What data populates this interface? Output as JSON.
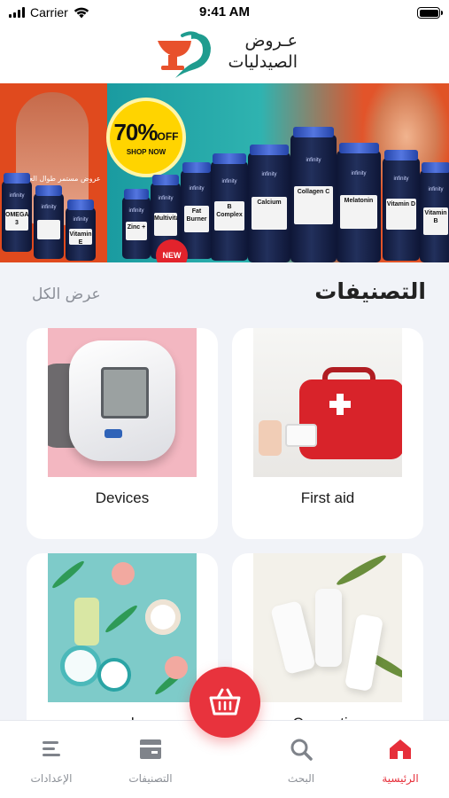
{
  "status_bar": {
    "carrier": "Carrier",
    "time": "9:41 AM"
  },
  "header": {
    "brand_line1": "عـروض",
    "brand_line2": "الصيدليات",
    "logo_colors": [
      "#e8512c",
      "#1f9c8f"
    ]
  },
  "banner": {
    "tagline": "عروض مستمر طوال العام",
    "offer_percent": "70%",
    "offer_word": "OFF",
    "offer_cta": "SHOP NOW",
    "new_badge": "NEW",
    "products": [
      "OMEGA 3",
      "Vitamin E",
      "Zinc +",
      "Multivitamin",
      "Fat Burner",
      "B Complex",
      "Calcium",
      "Collagen C",
      "Melatonin",
      "Vitamin D",
      "Vitamin B"
    ],
    "product_brand": "infinity"
  },
  "categories_section": {
    "title": "التصنيفات",
    "view_all": "عرض الكل"
  },
  "categories": [
    {
      "name": "First aid",
      "icon": "first-aid-kit-photo"
    },
    {
      "name": "Devices",
      "icon": "blood-pressure-monitor-photo"
    },
    {
      "name": "Cosmetics",
      "icon": "cosmetic-tubes-photo"
    },
    {
      "name": "personal care",
      "icon": "skincare-jars-photo"
    }
  ],
  "bottom_nav": {
    "items": [
      {
        "label": "الرئيسية",
        "icon": "home-icon",
        "active": true
      },
      {
        "label": "البحث",
        "icon": "search-icon",
        "active": false
      },
      {
        "label": "التصنيفات",
        "icon": "categories-icon",
        "active": false
      },
      {
        "label": "الإعدادات",
        "icon": "settings-icon",
        "active": false
      }
    ],
    "cart_icon": "basket-icon",
    "accent": "#e8333d"
  }
}
